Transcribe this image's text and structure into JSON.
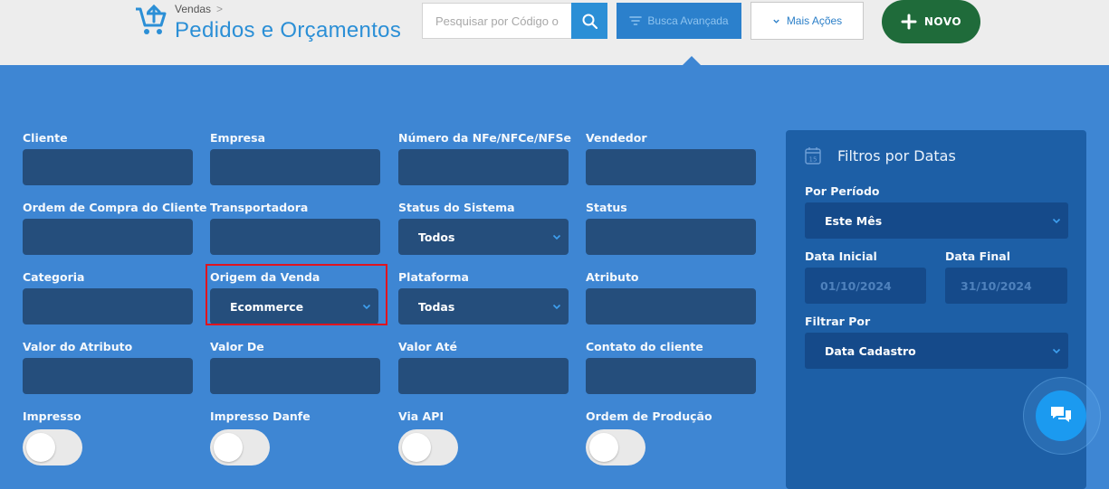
{
  "header": {
    "breadcrumb": "Vendas",
    "breadcrumb_sep": ">",
    "title": "Pedidos e Orçamentos",
    "search_placeholder": "Pesquisar por Código ou Cliente",
    "advanced_label": "Busca Avançada",
    "more_label": "Mais Ações",
    "new_label": "NOVO"
  },
  "filters": {
    "cliente": {
      "label": "Cliente",
      "value": ""
    },
    "empresa": {
      "label": "Empresa",
      "value": ""
    },
    "numero_nfe": {
      "label": "Número da NFe/NFCe/NFSe",
      "value": ""
    },
    "vendedor": {
      "label": "Vendedor",
      "value": ""
    },
    "ordem_compra": {
      "label": "Ordem de Compra do Cliente",
      "value": ""
    },
    "transportadora": {
      "label": "Transportadora",
      "value": ""
    },
    "status_sistema": {
      "label": "Status do Sistema",
      "value": "Todos"
    },
    "status": {
      "label": "Status",
      "value": ""
    },
    "categoria": {
      "label": "Categoria",
      "value": ""
    },
    "origem_venda": {
      "label": "Origem da Venda",
      "value": "Ecommerce"
    },
    "plataforma": {
      "label": "Plataforma",
      "value": "Todas"
    },
    "atributo": {
      "label": "Atributo",
      "value": ""
    },
    "valor_atributo": {
      "label": "Valor do Atributo",
      "value": ""
    },
    "valor_de": {
      "label": "Valor De",
      "value": ""
    },
    "valor_ate": {
      "label": "Valor Até",
      "value": ""
    },
    "contato_cliente": {
      "label": "Contato do cliente",
      "value": ""
    },
    "impresso": {
      "label": "Impresso",
      "on": false
    },
    "impresso_danfe": {
      "label": "Impresso Danfe",
      "on": false
    },
    "via_api": {
      "label": "Via API",
      "on": false
    },
    "ordem_producao": {
      "label": "Ordem de Produção",
      "on": false
    }
  },
  "date_filters": {
    "title": "Filtros por Datas",
    "periodo_label": "Por Período",
    "periodo_value": "Este Mês",
    "data_inicial_label": "Data Inicial",
    "data_inicial_value": "01/10/2024",
    "data_final_label": "Data Final",
    "data_final_value": "31/10/2024",
    "filtrar_por_label": "Filtrar Por",
    "filtrar_por_value": "Data Cadastro"
  },
  "colors": {
    "panel": "#3e86d3",
    "field_bg": "#254e7c",
    "date_panel": "#1d5fa6",
    "primary": "#2b8fd6",
    "new_button": "#1f6b3a",
    "highlight": "#e0141e"
  },
  "icons": {
    "logo": "cart-upload-icon",
    "search": "search-icon",
    "filter": "filter-icon",
    "more": "chevron-down-icon",
    "new": "plus-icon",
    "calendar": "calendar-icon",
    "chat": "chat-icon"
  }
}
